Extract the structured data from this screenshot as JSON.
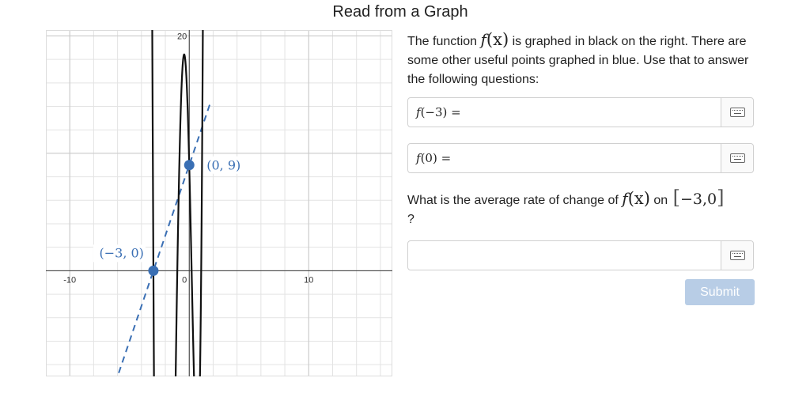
{
  "page": {
    "title": "Read from a Graph"
  },
  "graph": {
    "x_range": [
      -12,
      17
    ],
    "y_range": [
      -9,
      20.5
    ],
    "grid_step": 2,
    "axis_labels": {
      "x_minus_10": "-10",
      "x_zero": "0",
      "x_ten": "10",
      "y_twenty": "20"
    },
    "function_color": "#111111",
    "blue_color": "#3a6fb4",
    "point_a": {
      "x": -3,
      "y": 0,
      "label": "(−3, 0)"
    },
    "point_b": {
      "x": 0,
      "y": 9,
      "label": "(0, 9)"
    }
  },
  "question": {
    "text_before": "The function",
    "fx": "f",
    "fx_arg": "(x)",
    "text_after": " is graphed in black on the right. There are some other useful points graphed in blue. Use that to answer the following questions:",
    "rate_text": "What is the average rate of change of",
    "rate_on": "on",
    "interval_open": "[",
    "interval_value": "−3,0",
    "interval_close": "]",
    "trailing": "?"
  },
  "answers": {
    "q1_label_f": "f",
    "q1_label_rest": "(−3) =",
    "q2_label_f": "f",
    "q2_label_rest": "(0) =",
    "q1_value": "",
    "q2_value": "",
    "q3_value": ""
  },
  "submit_label": "Submit"
}
